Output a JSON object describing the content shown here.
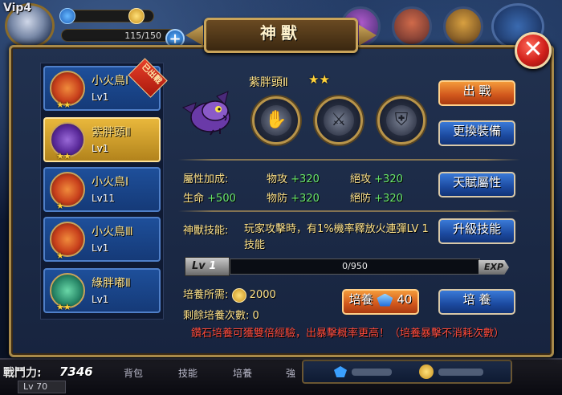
{
  "hud": {
    "vip_label": "Vip4",
    "hp_text": "115/150",
    "power_label": "戰鬥力:",
    "power_value": "7346",
    "level_text": "Lv 70",
    "bottom_tabs": [
      "背包",
      "技能",
      "培養",
      "強"
    ]
  },
  "window": {
    "title": "神獸",
    "close_icon": "close-icon"
  },
  "pets": [
    {
      "name": "小火鳥Ⅰ",
      "level": "Lv1",
      "stars": "★★",
      "color": "orange",
      "deployed_badge": "已出戰",
      "selected": false
    },
    {
      "name": "紫胖頭Ⅱ",
      "level": "Lv1",
      "stars": "★★",
      "color": "purple",
      "selected": true
    },
    {
      "name": "小火鳥Ⅰ",
      "level": "Lv11",
      "stars": "★",
      "color": "orange",
      "selected": false
    },
    {
      "name": "小火鳥Ⅲ",
      "level": "Lv1",
      "stars": "★",
      "color": "orange",
      "selected": false
    },
    {
      "name": "綠胖嘟Ⅱ",
      "level": "Lv1",
      "stars": "★★",
      "color": "green",
      "selected": false
    }
  ],
  "detail": {
    "name": "紫胖頭Ⅱ",
    "stars": "★★",
    "equip_slots": [
      "hand-wrap-icon",
      "claw-icon",
      "armor-icon"
    ],
    "stats_label": "屬性加成:",
    "stats": {
      "phys_atk_label": "物攻",
      "phys_atk": "+320",
      "abs_atk_label": "絕攻",
      "abs_atk": "+320",
      "hp_label": "生命",
      "hp": "+500",
      "phys_def_label": "物防",
      "phys_def": "+320",
      "abs_def_label": "絕防",
      "abs_def": "+320"
    },
    "skill_label": "神獸技能:",
    "skill_desc": "玩家攻擊時，有1%機率釋放火連彈LV 1技能",
    "exp": {
      "lv_prefix": "Lv",
      "lv": "1",
      "text": "0/950",
      "tag": "EXP",
      "fraction": 0
    },
    "cultivate_cost_label": "培養所需:",
    "cultivate_cost": "2000",
    "remaining_label": "剩餘培養次數:",
    "remaining": "0",
    "gem_cultivate_label": "培養",
    "gem_cultivate_cost": "40",
    "cultivate_label": "培 養",
    "warning": "鑽石培養可獲雙倍經驗，出暴擊概率更高！（培養暴擊不消耗次數）"
  },
  "buttons": {
    "deploy": "出 戰",
    "change_equip": "更換裝備",
    "talent": "天賦屬性",
    "upgrade_skill": "升級技能"
  },
  "colors": {
    "panel_border": "#a88a4a",
    "selected_item": "#e9b83c",
    "item_blue": "#1e4f9a",
    "bonus_green": "#6ae86a",
    "warning_red": "#ff4a3a"
  }
}
